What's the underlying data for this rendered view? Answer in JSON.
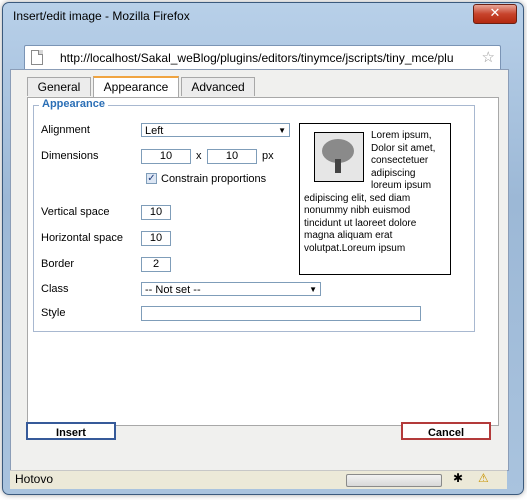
{
  "window": {
    "title": "Insert/edit image - Mozilla Firefox",
    "close_label": "✕"
  },
  "urlbar": {
    "url": "http://localhost/Sakal_weBlog/plugins/editors/tinymce/jscripts/tiny_mce/plu",
    "star_icon": "☆"
  },
  "tabs": [
    {
      "label": "General"
    },
    {
      "label": "Appearance"
    },
    {
      "label": "Advanced"
    }
  ],
  "appearance": {
    "legend": "Appearance",
    "alignment_label": "Alignment",
    "alignment_value": "Left",
    "dimensions_label": "Dimensions",
    "width_value": "10",
    "times": "x",
    "height_value": "10",
    "unit": "px",
    "constrain_label": "Constrain proportions",
    "constrain_checked": "✓",
    "vspace_label": "Vertical space",
    "vspace_value": "10",
    "hspace_label": "Horizontal space",
    "hspace_value": "10",
    "border_label": "Border",
    "border_value": "2",
    "class_label": "Class",
    "class_value": "-- Not set --",
    "style_label": "Style",
    "style_value": "",
    "preview_text": "Lorem ipsum, Dolor sit amet, consectetuer adipiscing loreum ipsum edipiscing elit, sed diam nonummy nibh euismod tincidunt ut laoreet dolore magna aliquam erat volutpat.Loreum ipsum"
  },
  "buttons": {
    "insert": "Insert",
    "cancel": "Cancel"
  },
  "status": {
    "text": "Hotovo",
    "bug_icon": "✱",
    "warn_icon": "⚠"
  },
  "icons": {
    "dropdown_arrow": "▼"
  }
}
